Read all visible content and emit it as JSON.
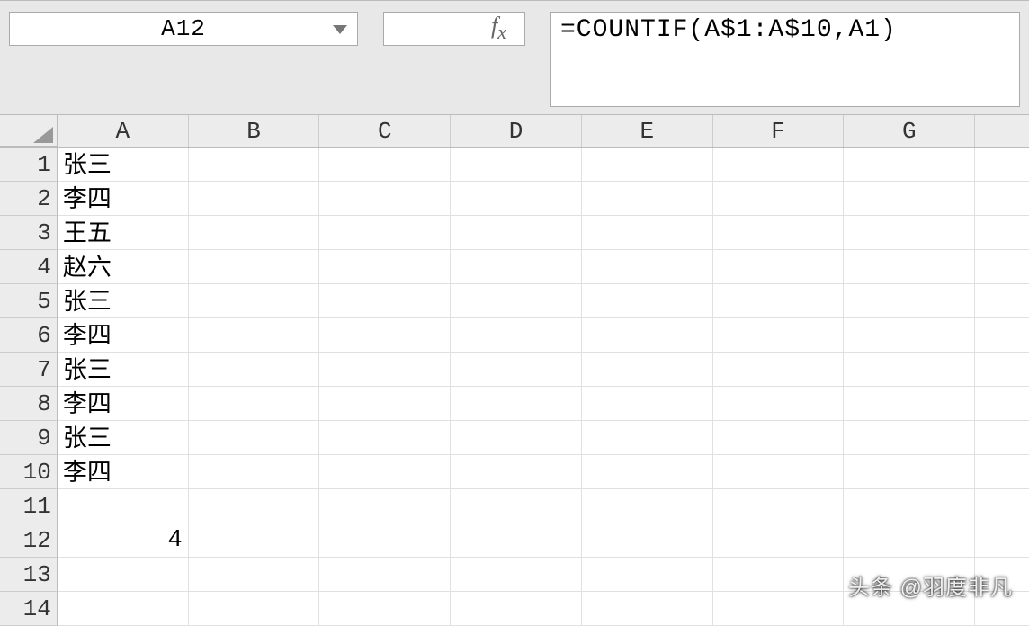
{
  "namebox": {
    "value": "A12"
  },
  "fx_label": "fx",
  "formula": "=COUNTIF(A$1:A$10,A1)",
  "columns": [
    "A",
    "B",
    "C",
    "D",
    "E",
    "F",
    "G"
  ],
  "rows": [
    {
      "num": 1,
      "A": "张三"
    },
    {
      "num": 2,
      "A": "李四"
    },
    {
      "num": 3,
      "A": "王五"
    },
    {
      "num": 4,
      "A": "赵六"
    },
    {
      "num": 5,
      "A": "张三"
    },
    {
      "num": 6,
      "A": "李四"
    },
    {
      "num": 7,
      "A": "张三"
    },
    {
      "num": 8,
      "A": "李四"
    },
    {
      "num": 9,
      "A": "张三"
    },
    {
      "num": 10,
      "A": "李四"
    },
    {
      "num": 11,
      "A": ""
    },
    {
      "num": 12,
      "A": "4",
      "A_numeric": true
    },
    {
      "num": 13,
      "A": ""
    },
    {
      "num": 14,
      "A": ""
    }
  ],
  "watermark": "头条 @羽度非凡"
}
